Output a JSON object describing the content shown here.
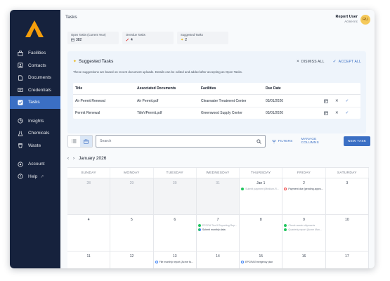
{
  "sidebar": {
    "items": [
      {
        "label": "Facilities",
        "icon": "facilities-icon"
      },
      {
        "label": "Contacts",
        "icon": "contacts-icon"
      },
      {
        "label": "Documents",
        "icon": "documents-icon"
      },
      {
        "label": "Credentials",
        "icon": "credentials-icon"
      },
      {
        "label": "Tasks",
        "icon": "tasks-icon",
        "active": true
      },
      {
        "label": "Insights",
        "icon": "insights-icon"
      },
      {
        "label": "Chemicals",
        "icon": "chemicals-icon"
      },
      {
        "label": "Waste",
        "icon": "waste-icon"
      },
      {
        "label": "Account",
        "icon": "account-icon"
      },
      {
        "label": "Help",
        "icon": "help-icon"
      }
    ]
  },
  "header": {
    "title": "Tasks",
    "user_name": "Report User",
    "user_org": "Acme Inc",
    "avatar_initials": "RU"
  },
  "stats": [
    {
      "label": "Open Tasks (Current Year)",
      "value": "382",
      "icon": "calendar-icon"
    },
    {
      "label": "Overdue Tasks",
      "value": "4",
      "icon": "overdue-icon"
    },
    {
      "label": "Suggested Tasks",
      "value": "2",
      "icon": "lightbulb-icon"
    }
  ],
  "suggested": {
    "title": "Suggested Tasks",
    "dismiss_all": "DISMISS ALL",
    "accept_all": "ACCEPT ALL",
    "note": "These suggestions are based on recent document uploads. Details can be edited and added after accepting as Open Tasks.",
    "columns": [
      "Title",
      "Associated Documents",
      "Facilities",
      "Due Date"
    ],
    "rows": [
      {
        "title": "Air Permit Renewal",
        "document": "Air Permit.pdf",
        "facility": "Clearwater Treatment Center",
        "due": "03/01/2026"
      },
      {
        "title": "Permit Renewal",
        "document": "TitleVPermit.pdf",
        "facility": "Greenwood Supply Center",
        "due": "03/01/2026"
      }
    ]
  },
  "toolbar": {
    "search_placeholder": "Search",
    "filters": "FILTERS",
    "manage_columns": "MANAGE COLUMNS",
    "new_task": "NEW TASK"
  },
  "calendar": {
    "month": "January 2026",
    "weekdays": [
      "SUNDAY",
      "MONDAY",
      "TUESDAY",
      "WEDNESDAY",
      "THURSDAY",
      "FRIDAY",
      "SATURDAY"
    ],
    "weeks": [
      [
        {
          "day": "28",
          "outside": true,
          "events": []
        },
        {
          "day": "29",
          "outside": true,
          "events": []
        },
        {
          "day": "30",
          "outside": true,
          "events": []
        },
        {
          "day": "31",
          "outside": true,
          "events": []
        },
        {
          "day": "Jan 1",
          "outside": false,
          "events": [
            {
              "text": "Submit payment (Medium-R...",
              "status": "green",
              "dim": true
            }
          ]
        },
        {
          "day": "2",
          "outside": false,
          "events": [
            {
              "text": "Payment due (pending appro...",
              "status": "ring-red"
            }
          ]
        },
        {
          "day": "3",
          "outside": false,
          "events": []
        }
      ],
      [
        {
          "day": "4",
          "outside": false,
          "events": []
        },
        {
          "day": "5",
          "outside": false,
          "events": []
        },
        {
          "day": "6",
          "outside": false,
          "events": []
        },
        {
          "day": "7",
          "outside": false,
          "events": [
            {
              "text": "EPCRA Tier II Reporting Rep...",
              "status": "green",
              "dim": true
            },
            {
              "text": "Submit monthly data",
              "status": "half"
            }
          ]
        },
        {
          "day": "8",
          "outside": false,
          "events": []
        },
        {
          "day": "9",
          "outside": false,
          "events": [
            {
              "text": "Check waste shipments",
              "status": "green",
              "dim": true
            },
            {
              "text": "Quarterly report (Acme Man...",
              "status": "green",
              "dim": true
            }
          ]
        },
        {
          "day": "10",
          "outside": false,
          "events": []
        }
      ],
      [
        {
          "day": "11",
          "outside": false,
          "events": []
        },
        {
          "day": "12",
          "outside": false,
          "events": []
        },
        {
          "day": "13",
          "outside": false,
          "events": [
            {
              "text": "File monthly report (Acme fa...",
              "status": "ring-blue"
            }
          ]
        },
        {
          "day": "14",
          "outside": false,
          "events": []
        },
        {
          "day": "15",
          "outside": false,
          "events": [
            {
              "text": "EPCRA Emergency plan",
              "status": "ring-blue"
            }
          ]
        },
        {
          "day": "16",
          "outside": false,
          "events": []
        },
        {
          "day": "17",
          "outside": false,
          "events": []
        }
      ]
    ]
  },
  "colors": {
    "sidebar_bg": "#16223d",
    "accent": "#3b6fc4",
    "logo": "#f59e0b"
  }
}
